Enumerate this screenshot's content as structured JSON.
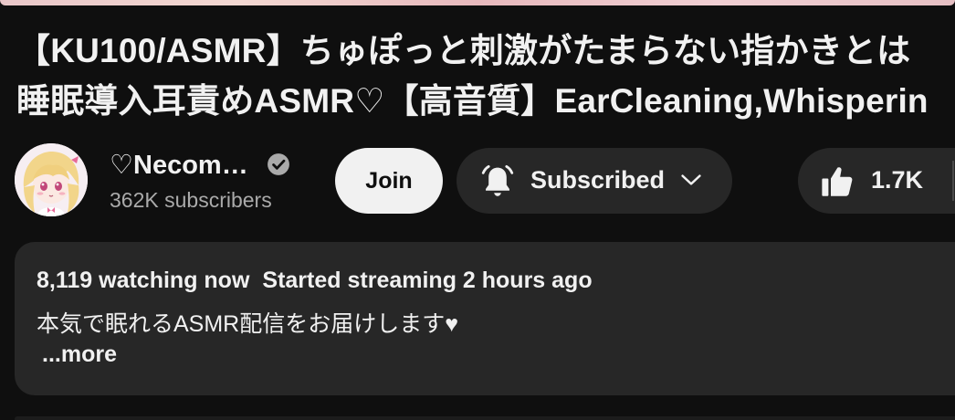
{
  "video": {
    "title_line1": "【KU100/ASMR】ちゅぽっと刺激がたまらない指かきとは",
    "title_line2": "睡眠導入耳責めASMR♡【高音質】EarCleaning,Whisperin"
  },
  "channel": {
    "name": "♡Necom…",
    "subscribers": "362K subscribers",
    "verified_icon": "verified-check-icon",
    "avatar_bg": "#f6eef2"
  },
  "actions": {
    "join_label": "Join",
    "subscribed_label": "Subscribed",
    "like_count": "1.7K"
  },
  "description": {
    "watching": "8,119 watching now",
    "started": "Started streaming 2 hours ago",
    "text": "本気で眠れるASMR配信をお届けします♥",
    "more": "...more"
  },
  "colors": {
    "background": "#0f0f0f",
    "button_dark": "#272727",
    "button_light": "#f1f1f1",
    "secondary_text": "#aaaaaa"
  }
}
